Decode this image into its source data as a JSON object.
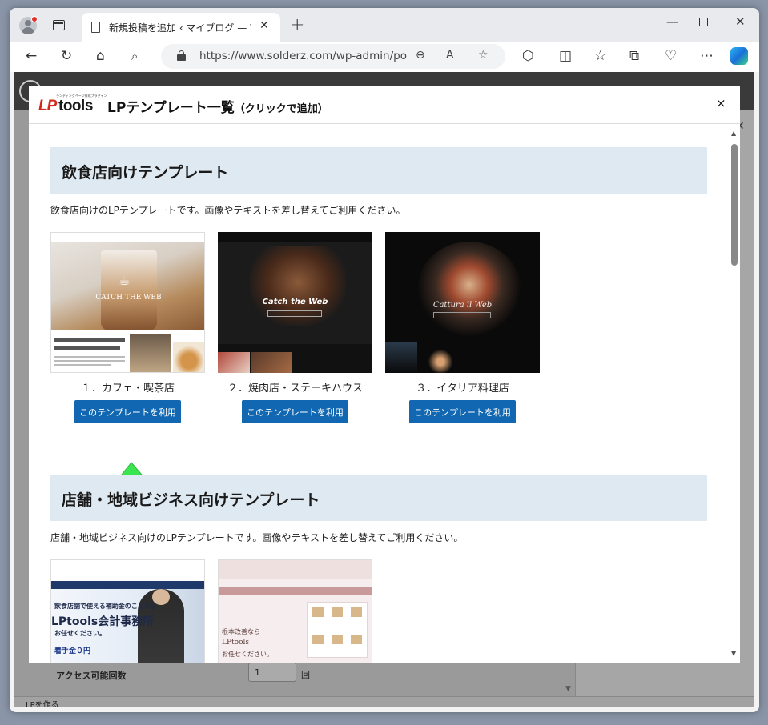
{
  "browser": {
    "tab_title": "新規投稿を追加 ‹ マイブログ — Wo",
    "url": "https://www.solderz.com/wp-admin/po...",
    "colors": {
      "frame": "#e8eaed",
      "toolbar": "#ffffff"
    }
  },
  "wp": {
    "field_label": "アクセス可能回数",
    "field_value": "1",
    "field_unit": "回",
    "footer": "LPを作る"
  },
  "modal": {
    "logo_tagline": "ランディングページ作成プラグイン",
    "logo_lp": "LP",
    "logo_tools": "tools",
    "title": "LPテンプレート一覧",
    "title_sub": "（クリックで追加）",
    "close": "×"
  },
  "sections": [
    {
      "heading": "飲食店向けテンプレート",
      "description": "飲食店向けのLPテンプレートです。画像やテキストを差し替えてご利用ください。",
      "templates": [
        {
          "label": "１．カフェ・喫茶店",
          "button": "このテンプレートを利用",
          "overlay": "CATCH THE WEB"
        },
        {
          "label": "２．焼肉店・ステーキハウス",
          "button": "このテンプレートを利用",
          "overlay": "Catch the Web"
        },
        {
          "label": "３．イタリア料理店",
          "button": "このテンプレートを利用",
          "overlay": "Cattura il Web"
        }
      ]
    },
    {
      "heading": "店舗・地域ビジネス向けテンプレート",
      "description": "店舗・地域ビジネス向けのLPテンプレートです。画像やテキストを差し替えてご利用ください。",
      "templates": [
        {
          "overlay_lines": [
            "飲食店舗で使える補助金のことなら",
            "LPtools会計事務所",
            "お任せください。",
            "着手金０円"
          ]
        },
        {
          "overlay_lines": [
            "根本改善なら",
            "LPtools",
            "お任せください。"
          ]
        }
      ]
    }
  ],
  "accent_colors": {
    "button": "#1167b1",
    "section_bg": "#dfe9f2",
    "arrow": "#39e64f"
  }
}
